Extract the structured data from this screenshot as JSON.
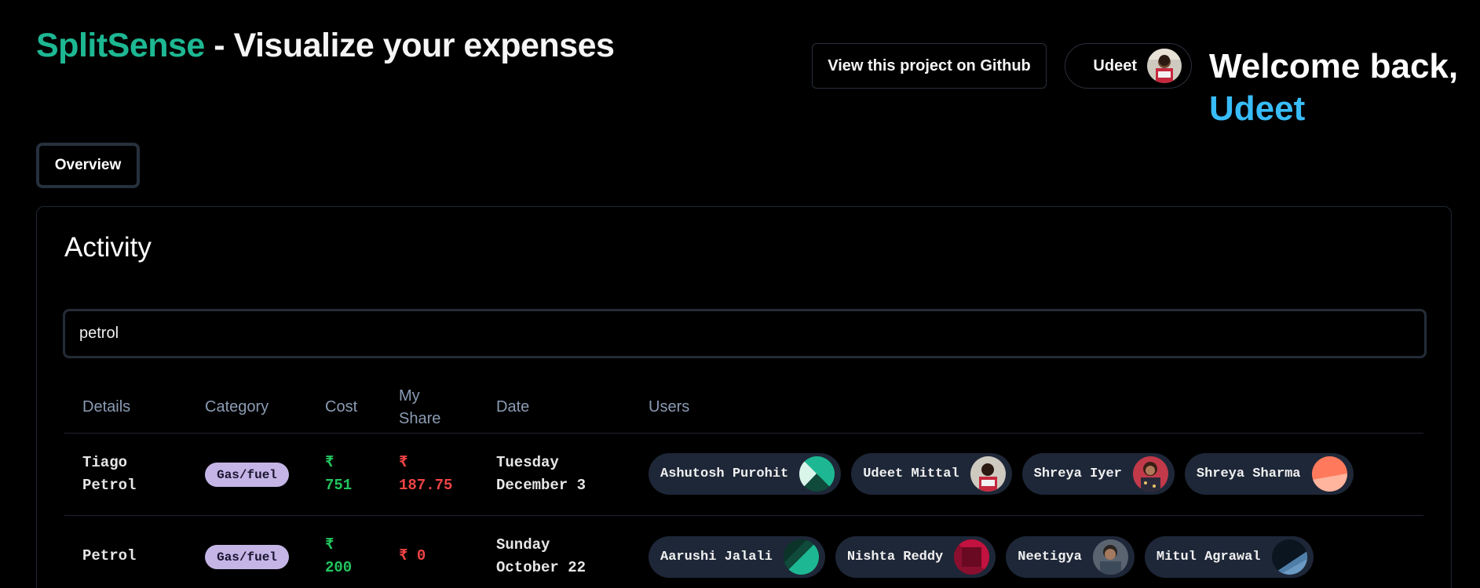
{
  "header": {
    "brand_name": "SplitSense",
    "brand_tagline": " - Visualize your expenses",
    "github_button": "View this project on Github",
    "user_name": "Udeet",
    "welcome_line1": "Welcome back,",
    "welcome_line2": "Udeet"
  },
  "tabs": {
    "overview": "Overview"
  },
  "activity": {
    "title": "Activity",
    "search": {
      "value": "petrol",
      "placeholder": ""
    },
    "columns": {
      "details": "Details",
      "category": "Category",
      "cost": "Cost",
      "my_share_1": "My",
      "my_share_2": "Share",
      "date": "Date",
      "users": "Users"
    },
    "rows": [
      {
        "details_1": "Tiago",
        "details_2": "Petrol",
        "category": "Gas/fuel",
        "cost_1": "₹",
        "cost_2": "751",
        "share_1": "₹",
        "share_2": "187.75",
        "date_1": "Tuesday",
        "date_2": "December 3",
        "users": [
          {
            "name": "Ashutosh Purohit"
          },
          {
            "name": "Udeet Mittal"
          },
          {
            "name": "Shreya Iyer"
          },
          {
            "name": "Shreya Sharma"
          }
        ]
      },
      {
        "details_1": "Petrol",
        "category": "Gas/fuel",
        "cost_1": "₹",
        "cost_2": "200",
        "share_1": "₹ 0",
        "date_1": "Sunday",
        "date_2": "October 22",
        "users": [
          {
            "name": "Aarushi Jalali"
          },
          {
            "name": "Nishta Reddy"
          },
          {
            "name": "Neetigya"
          },
          {
            "name": "Mitul Agrawal"
          }
        ]
      }
    ]
  },
  "colors": {
    "brand_accent": "#1db893",
    "welcome_accent": "#38bdf8",
    "cost_positive": "#22c55e",
    "share_negative": "#ef4444",
    "category_badge": "#c4b5e6",
    "user_chip": "#1e2738"
  }
}
